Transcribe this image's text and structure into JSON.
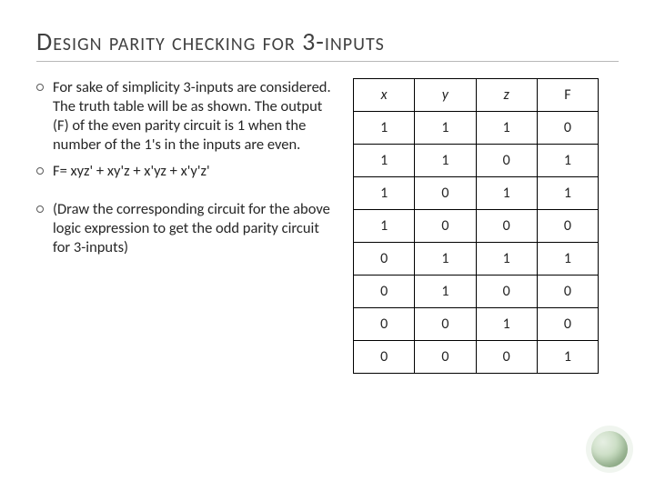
{
  "title": "Design parity checking for 3-inputs",
  "bullets": [
    "For sake of simplicity 3-inputs are considered. The truth table will be as shown. The output (F) of the even parity circuit is 1 when the number of the 1's in the inputs are even.",
    "F= xyz' + xy'z + x'yz + x'y'z'",
    "(Draw the corresponding circuit for the above logic expression to get the odd parity circuit for 3-inputs)"
  ],
  "table": {
    "headers": [
      "x",
      "y",
      "z",
      "F"
    ],
    "rows": [
      [
        "1",
        "1",
        "1",
        "0"
      ],
      [
        "1",
        "1",
        "0",
        "1"
      ],
      [
        "1",
        "0",
        "1",
        "1"
      ],
      [
        "1",
        "0",
        "0",
        "0"
      ],
      [
        "0",
        "1",
        "1",
        "1"
      ],
      [
        "0",
        "1",
        "0",
        "0"
      ],
      [
        "0",
        "0",
        "1",
        "0"
      ],
      [
        "0",
        "0",
        "0",
        "1"
      ]
    ]
  }
}
